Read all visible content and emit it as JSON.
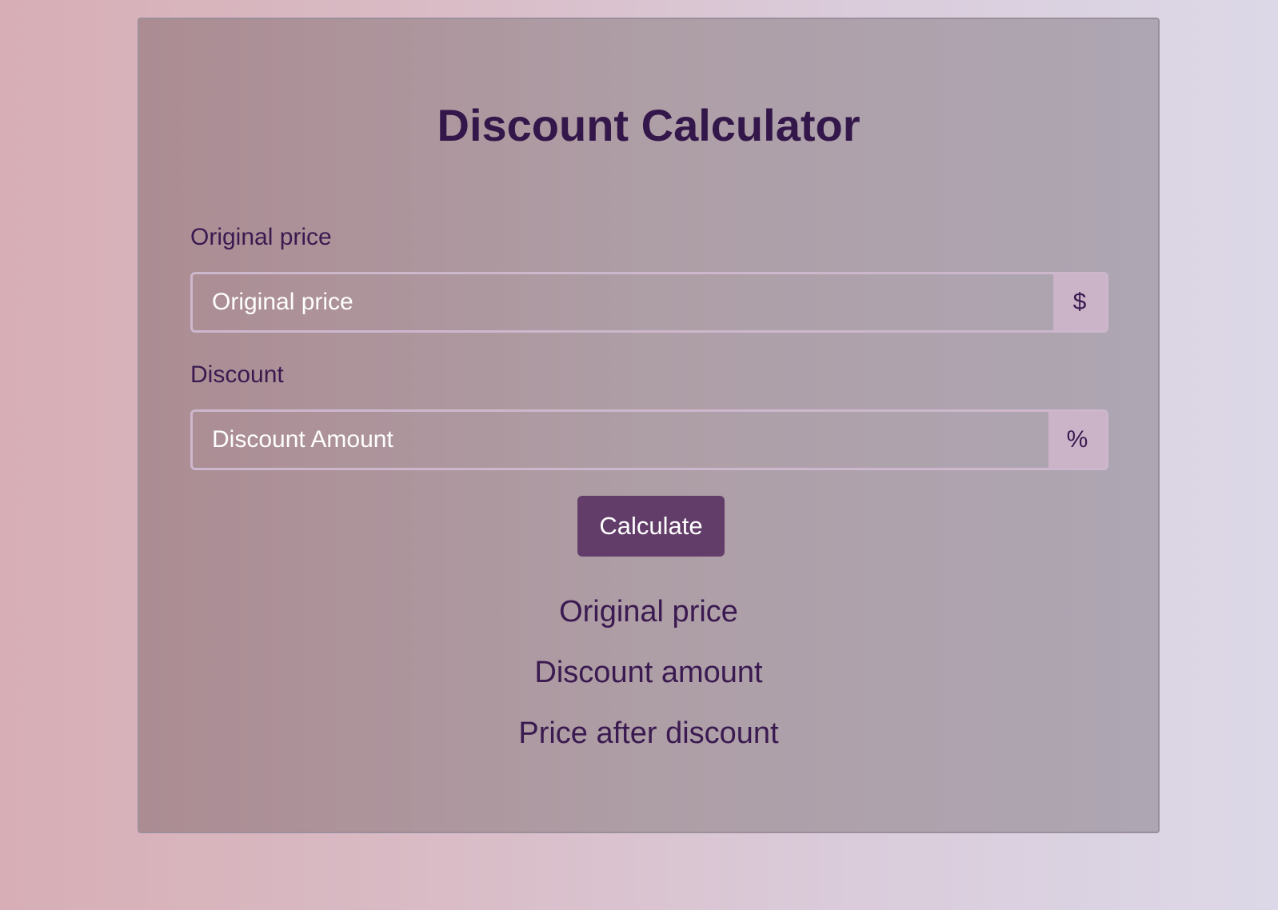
{
  "app": {
    "title": "Discount Calculator"
  },
  "form": {
    "price_label": "Original price",
    "price_placeholder": "Original price",
    "price_value": "",
    "price_addon": "$",
    "discount_label": "Discount",
    "discount_placeholder": "Discount Amount",
    "discount_value": "",
    "discount_addon": "%",
    "calculate_label": "Calculate"
  },
  "results": {
    "original_price": "Original price",
    "discount_amount": "Discount amount",
    "price_after_discount": "Price after discount"
  },
  "colors": {
    "accent": "#633d69",
    "text": "#3a1a50",
    "addon_bg": "#cbb3c8"
  }
}
